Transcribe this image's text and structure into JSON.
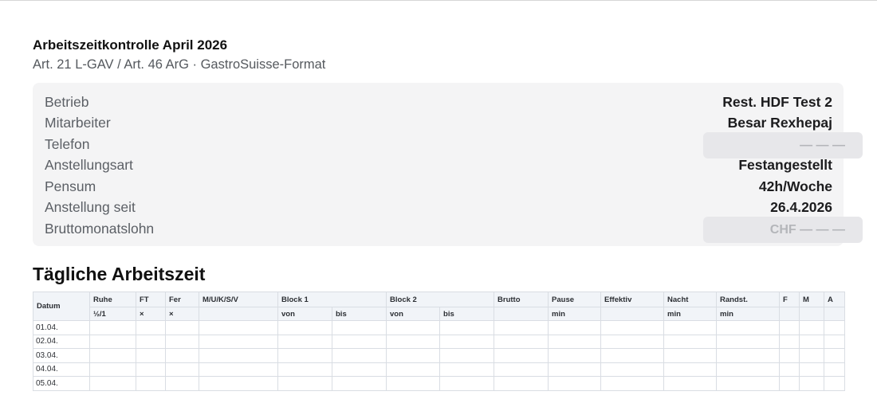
{
  "document": {
    "title": "Arbeitszeitkontrolle April 2026",
    "subtitle": "Art. 21 L-GAV / Art. 46 ArG · GastroSuisse-Format"
  },
  "info": {
    "betrieb": {
      "label": "Betrieb",
      "value": "Rest. HDF Test 2"
    },
    "mitarbeiter": {
      "label": "Mitarbeiter",
      "value": "Besar Rexhepaj"
    },
    "telefon": {
      "label": "Telefon",
      "value": "— — —"
    },
    "anstellungsart": {
      "label": "Anstellungsart",
      "value": "Festangestellt"
    },
    "pensum": {
      "label": "Pensum",
      "value": "42h/Woche"
    },
    "anstellung_seit": {
      "label": "Anstellung seit",
      "value": "26.4.2026"
    },
    "bruttomonatslohn": {
      "label": "Bruttomonatslohn",
      "value": "CHF — — —"
    }
  },
  "table_section": {
    "title": "Tägliche Arbeitszeit",
    "headers": {
      "datum": "Datum",
      "ruhe": "Ruhe",
      "ft": "FT",
      "fer": "Fer",
      "mukssv": "M/U/K/S/V",
      "block1": "Block 1",
      "block2": "Block 2",
      "brutto": "Brutto",
      "pause": "Pause",
      "effektiv": "Effektiv",
      "nacht": "Nacht",
      "randst": "Randst.",
      "f": "F",
      "m": "M",
      "a": "A"
    },
    "subheaders": {
      "ruhe": "½/1",
      "ft": "×",
      "fer": "×",
      "b1_von": "von",
      "b1_bis": "bis",
      "b2_von": "von",
      "b2_bis": "bis",
      "pause": "min",
      "nacht": "min",
      "randst": "min"
    },
    "rows": [
      "01.04.",
      "02.04.",
      "03.04.",
      "04.04.",
      "05.04."
    ]
  }
}
